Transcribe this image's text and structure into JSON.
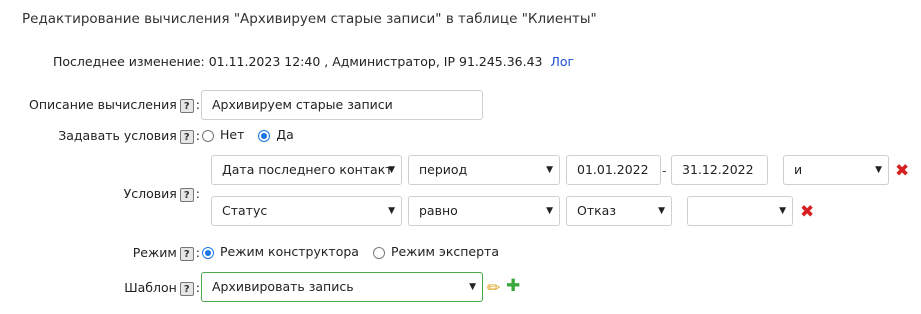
{
  "title": "Редактирование вычисления \"Архивируем старые записи\" в таблице \"Клиенты\"",
  "last_modified": {
    "label": "Последнее изменение:",
    "value": "01.11.2023 12:40 , Администратор, IP 91.245.36.43",
    "log_link": "Лог"
  },
  "help_glyph": "?",
  "description": {
    "label": "Описание вычисления",
    "value": "Архивируем старые записи"
  },
  "set_conditions": {
    "label": "Задавать условия",
    "options": [
      "Нет",
      "Да"
    ],
    "selected": "Да"
  },
  "conditions": {
    "label": "Условия",
    "rows": [
      {
        "field": "Дата последнего контакт",
        "operator": "период",
        "from": "01.01.2022",
        "separator": "-",
        "to": "31.12.2022",
        "logic": "и"
      },
      {
        "field": "Статус",
        "operator": "равно",
        "value": "Отказ",
        "logic": ""
      }
    ],
    "delete_glyph": "✖"
  },
  "mode": {
    "label": "Режим",
    "options": [
      "Режим конструктора",
      "Режим эксперта"
    ],
    "selected": "Режим конструктора"
  },
  "template": {
    "label": "Шаблон",
    "value": "Архивировать запись"
  },
  "icons": {
    "select_arrow": "▼",
    "edit": "✏",
    "add": "✚"
  },
  "colors": {
    "link": "#1a4fd6",
    "accent": "#1a73e8",
    "delete": "#d62020",
    "template_border": "#4aa84a",
    "add": "#3aa83a",
    "edit": "#d9a21b"
  }
}
